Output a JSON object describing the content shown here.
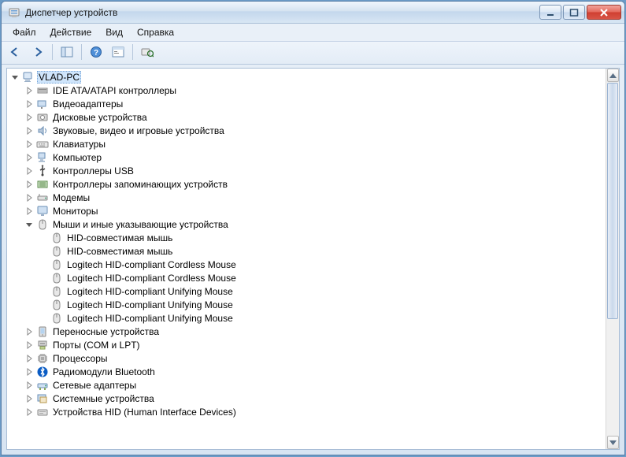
{
  "window": {
    "title": "Диспетчер устройств"
  },
  "menu": {
    "file": "Файл",
    "action": "Действие",
    "view": "Вид",
    "help": "Справка"
  },
  "toolbar": {
    "back": "Назад",
    "forward": "Вперёд",
    "show_hide": "Показать/скрыть дерево консоли",
    "help": "Справка",
    "properties": "Свойства",
    "scan": "Обновить конфигурацию оборудования"
  },
  "root": {
    "label": "VLAD-PC"
  },
  "categories": [
    {
      "label": "IDE ATA/ATAPI контроллеры",
      "icon": "ide-icon"
    },
    {
      "label": "Видеоадаптеры",
      "icon": "display-adapter-icon"
    },
    {
      "label": "Дисковые устройства",
      "icon": "disk-icon"
    },
    {
      "label": "Звуковые, видео и игровые устройства",
      "icon": "sound-icon"
    },
    {
      "label": "Клавиатуры",
      "icon": "keyboard-icon"
    },
    {
      "label": "Компьютер",
      "icon": "computer-icon"
    },
    {
      "label": "Контроллеры USB",
      "icon": "usb-icon"
    },
    {
      "label": "Контроллеры запоминающих устройств",
      "icon": "storage-controller-icon"
    },
    {
      "label": "Модемы",
      "icon": "modem-icon"
    },
    {
      "label": "Мониторы",
      "icon": "monitor-icon"
    },
    {
      "label": "Мыши и иные указывающие устройства",
      "icon": "mouse-icon",
      "expanded": true,
      "children": [
        {
          "label": "HID-совместимая мышь",
          "icon": "mouse-icon"
        },
        {
          "label": "HID-совместимая мышь",
          "icon": "mouse-icon"
        },
        {
          "label": "Logitech HID-compliant Cordless Mouse",
          "icon": "mouse-icon"
        },
        {
          "label": "Logitech HID-compliant Cordless Mouse",
          "icon": "mouse-icon"
        },
        {
          "label": "Logitech HID-compliant Unifying Mouse",
          "icon": "mouse-icon"
        },
        {
          "label": "Logitech HID-compliant Unifying Mouse",
          "icon": "mouse-icon"
        },
        {
          "label": "Logitech HID-compliant Unifying Mouse",
          "icon": "mouse-icon"
        }
      ]
    },
    {
      "label": "Переносные устройства",
      "icon": "portable-icon"
    },
    {
      "label": "Порты (COM и LPT)",
      "icon": "port-icon"
    },
    {
      "label": "Процессоры",
      "icon": "cpu-icon"
    },
    {
      "label": "Радиомодули Bluetooth",
      "icon": "bluetooth-icon"
    },
    {
      "label": "Сетевые адаптеры",
      "icon": "network-icon"
    },
    {
      "label": "Системные устройства",
      "icon": "system-icon"
    },
    {
      "label": "Устройства HID (Human Interface Devices)",
      "icon": "hid-icon"
    }
  ],
  "colors": {
    "selection": "#cfe5fb",
    "frame": "#d5e3f1",
    "close": "#cf3f31",
    "bluetooth": "#0a5cc4"
  }
}
